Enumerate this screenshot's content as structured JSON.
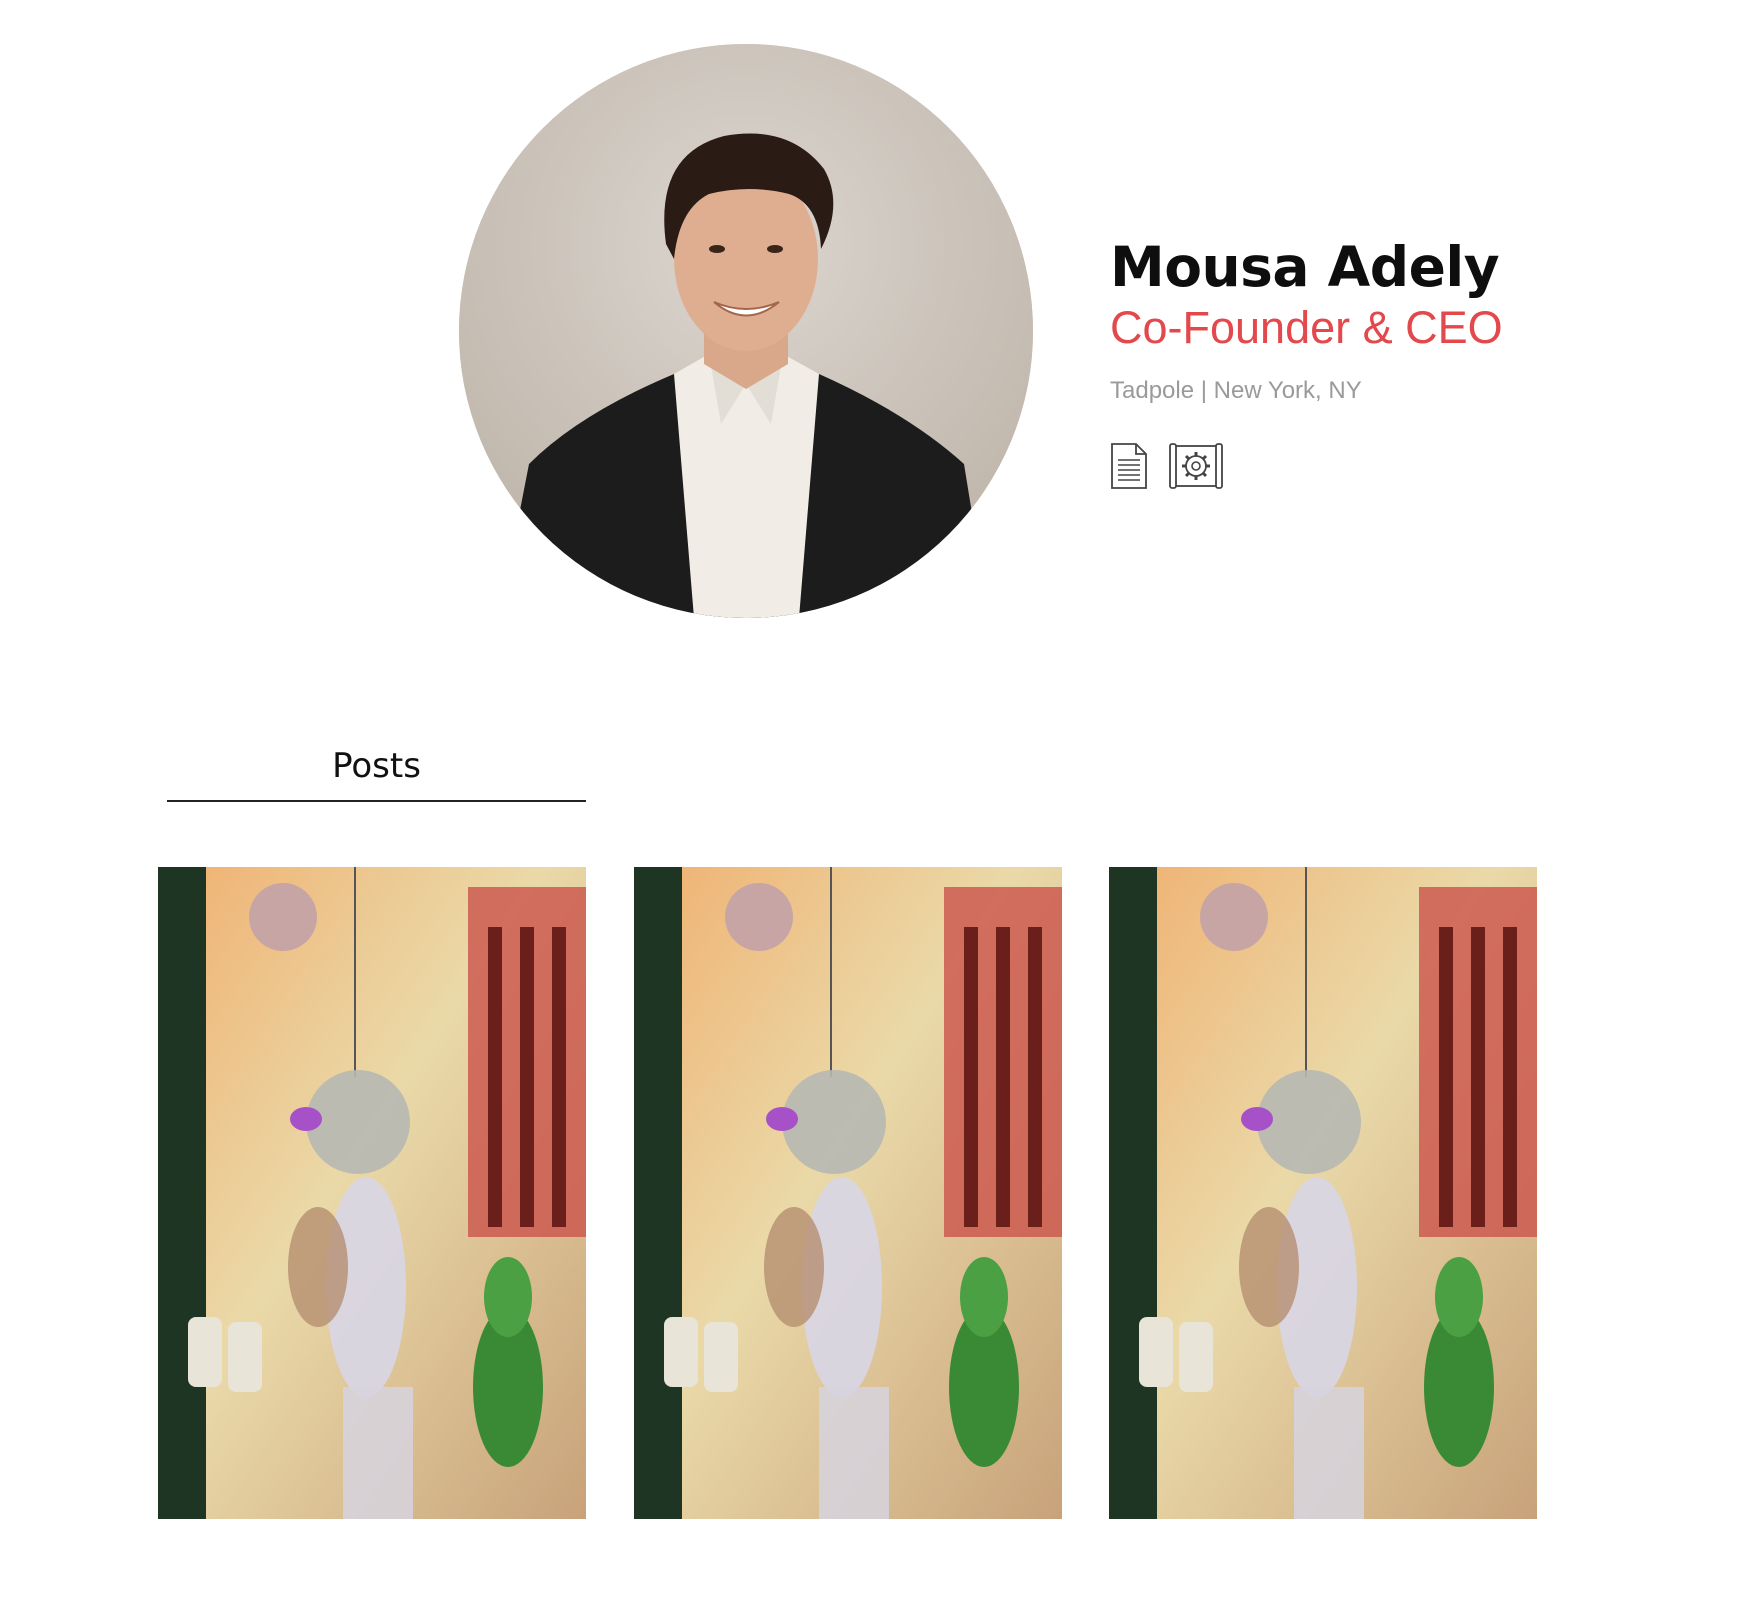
{
  "profile": {
    "name": "Mousa Adely",
    "role": "Co-Founder & CEO",
    "org_location": "Tadpole | New York, NY",
    "avatar_icon": "person-photo",
    "role_color": "#e3484c"
  },
  "actions": [
    {
      "icon": "document-icon"
    },
    {
      "icon": "gear-scroll-icon"
    }
  ],
  "tabs": [
    {
      "label": "Posts",
      "active": true
    }
  ],
  "posts": [
    {
      "image": "hanging-glass-jars-street-photo"
    },
    {
      "image": "hanging-glass-jars-street-photo"
    },
    {
      "image": "hanging-glass-jars-street-photo"
    }
  ]
}
